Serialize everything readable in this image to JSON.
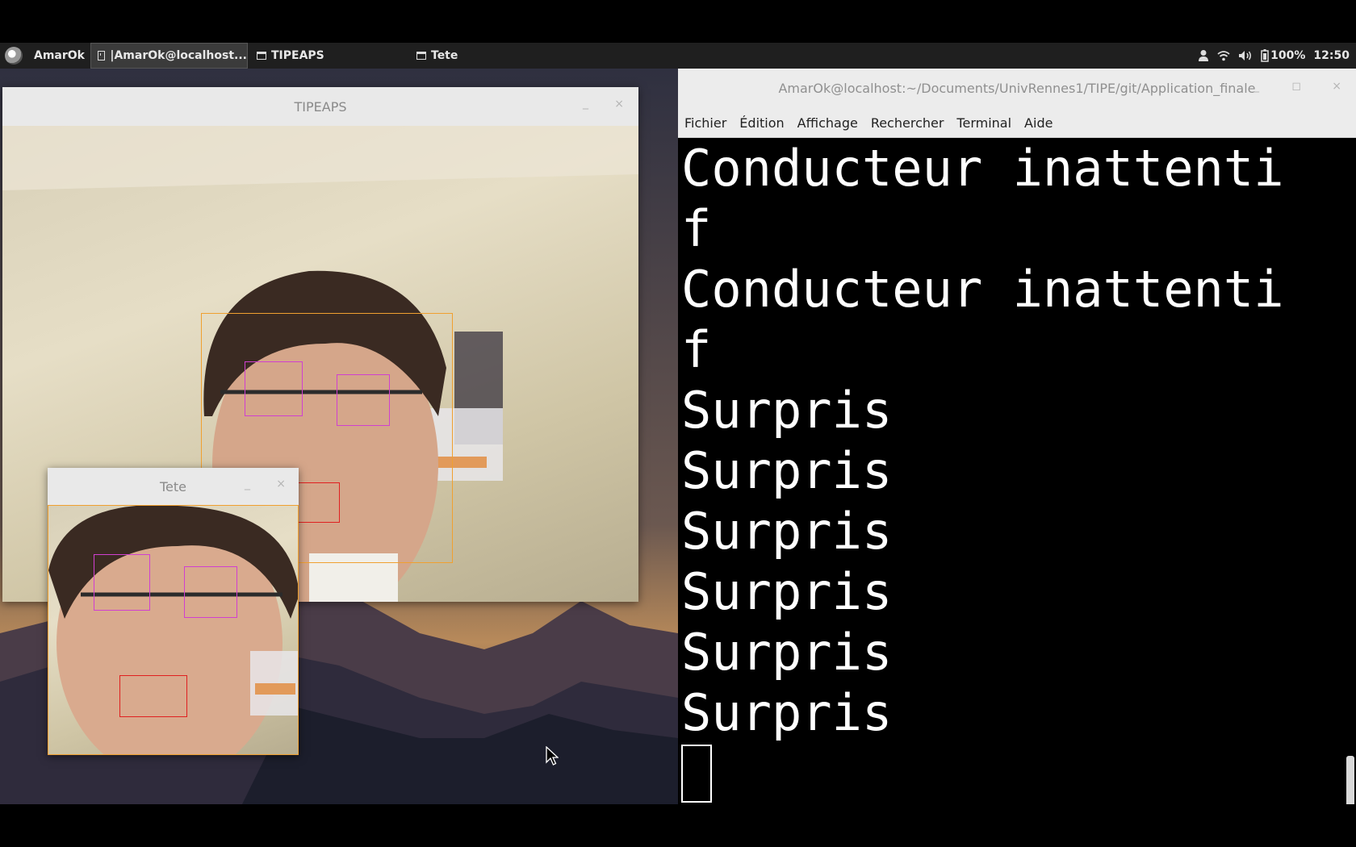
{
  "taskbar": {
    "app_name": "AmarOk",
    "tasks": [
      {
        "label": "|AmarOk@localhost...",
        "icon": "terminal-icon",
        "active": true
      },
      {
        "label": "TIPEAPS",
        "icon": "window-icon",
        "active": false
      },
      {
        "label": "Tete",
        "icon": "window-icon",
        "active": false
      }
    ],
    "battery": "100%",
    "clock": "12:50"
  },
  "windows": {
    "tipeaps": {
      "title": "TIPEAPS",
      "minimize": "_",
      "close": "×"
    },
    "tete": {
      "title": "Tete",
      "minimize": "_",
      "close": "×"
    }
  },
  "terminal": {
    "title": "AmarOk@localhost:~/Documents/UnivRennes1/TIPE/git/Application_finale",
    "menu": [
      "Fichier",
      "Édition",
      "Affichage",
      "Rechercher",
      "Terminal",
      "Aide"
    ],
    "lines": [
      "Conducteur inattenti",
      "f",
      "Conducteur inattenti",
      "f",
      "Surpris",
      "Surpris",
      "Surpris",
      "Surpris",
      "Surpris",
      "Surpris"
    ]
  },
  "colors": {
    "face_box": "#f0a030",
    "eye_box": "#d040d0",
    "mouth_box": "#e02020",
    "taskbar_bg": "#1f1f1f",
    "terminal_bg": "#000000"
  }
}
